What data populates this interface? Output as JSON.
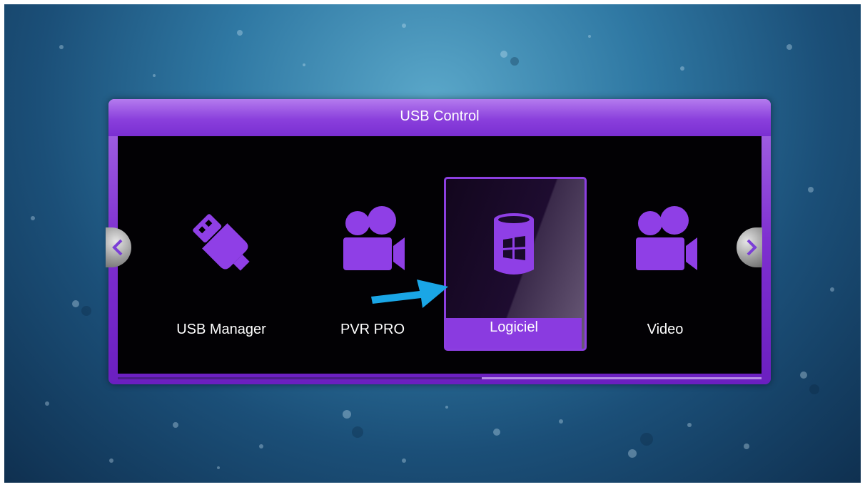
{
  "window": {
    "title": "USB Control"
  },
  "menu": {
    "items": [
      {
        "label": "USB Manager",
        "icon": "usb-drive-icon"
      },
      {
        "label": "PVR PRO",
        "icon": "video-camera-icon"
      },
      {
        "label": "Logiciel",
        "icon": "software-database-icon"
      },
      {
        "label": "Video",
        "icon": "video-camera-icon"
      }
    ],
    "selected_label": "Logiciel"
  },
  "colors": {
    "accent": "#8a3be0",
    "panel": "#020104",
    "pointer_arrow": "#1aa6e6"
  }
}
